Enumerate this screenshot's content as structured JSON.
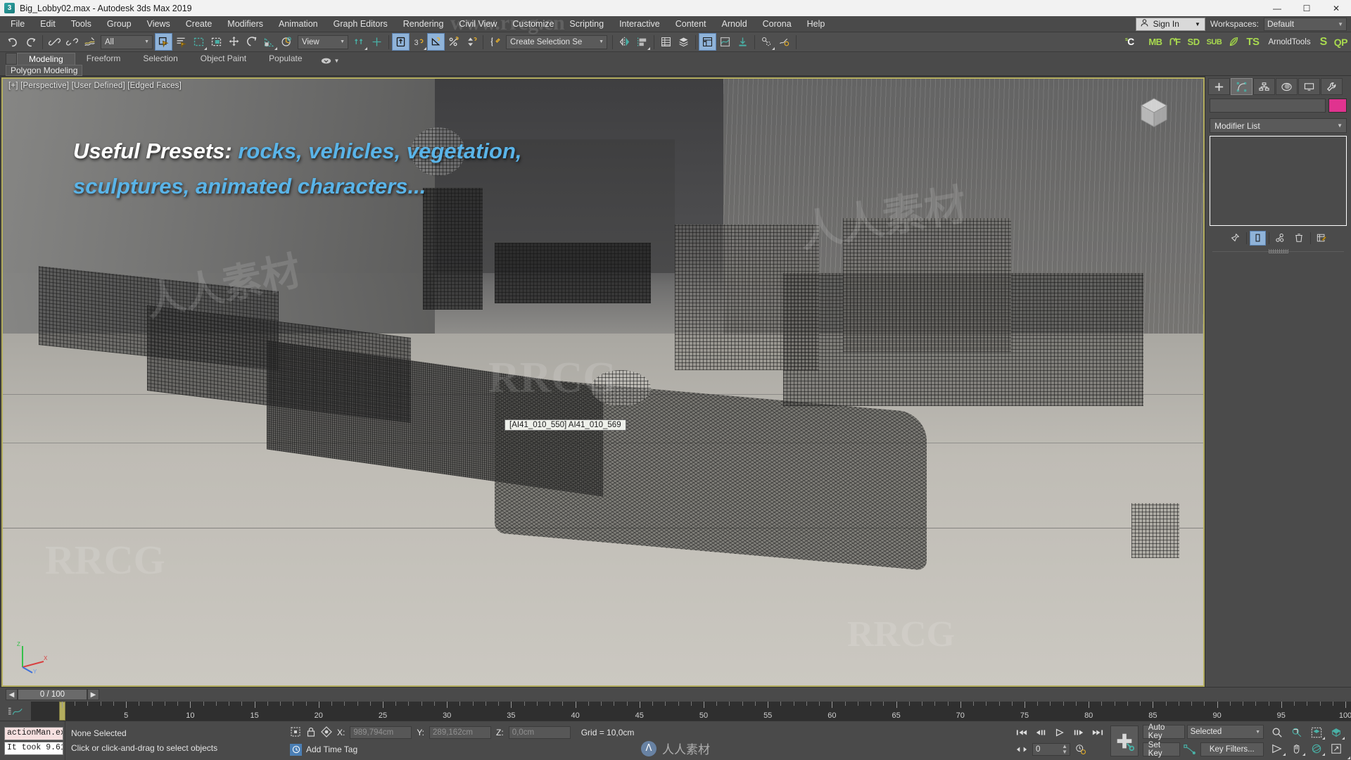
{
  "window": {
    "title": "Big_Lobby02.max - Autodesk 3ds Max 2019",
    "app_icon": "3",
    "minimize": "—",
    "maximize": "☐",
    "close": "✕"
  },
  "menubar": {
    "items": [
      "File",
      "Edit",
      "Tools",
      "Group",
      "Views",
      "Create",
      "Modifiers",
      "Animation",
      "Graph Editors",
      "Rendering",
      "Civil View",
      "Customize",
      "Scripting",
      "Interactive",
      "Content",
      "Arnold",
      "Corona",
      "Help"
    ],
    "sign_in": "Sign In",
    "workspaces_label": "Workspaces:",
    "workspace_value": "Default"
  },
  "toolbar": {
    "selection_filter": "All",
    "reference_coordinate": "View",
    "named_selection_sets": "Create Selection Se",
    "arnold_tools_label": "ArnoldTools",
    "plugin_icons": [
      "SC",
      "MB",
      "FF",
      "SD",
      "SUB",
      "leaf-icon",
      "TS",
      "S",
      "QP"
    ]
  },
  "ribbon": {
    "tabs": [
      "Modeling",
      "Freeform",
      "Selection",
      "Object Paint",
      "Populate"
    ],
    "active_tab": "Modeling",
    "panel_label": "Polygon Modeling"
  },
  "viewport": {
    "label": "[+] [Perspective] [User Defined] [Edged Faces]",
    "tooltip": "[AI41_010_550] AI41_010_569",
    "overlay_title": "Useful Presets:",
    "overlay_accent_line1": " rocks, vehicles, vegetation,",
    "overlay_accent_line2": "sculptures, animated characters...",
    "accent_color": "#5ab4e8",
    "border_color": "#b3ad5e",
    "axis_x": "X",
    "axis_y": "Y",
    "axis_z": "Z"
  },
  "command_panel": {
    "tabs": [
      "create-tab",
      "modify-tab",
      "hierarchy-tab",
      "motion-tab",
      "display-tab",
      "utilities-tab"
    ],
    "active_tab_index": 1,
    "object_name": "",
    "color_swatch": "#e0338f",
    "modifier_list": "Modifier List"
  },
  "timeline": {
    "frame_display": "0 / 100",
    "prev_arrow": "◀",
    "next_arrow": "▶",
    "tick_labels": [
      "5",
      "10",
      "15",
      "20",
      "25",
      "30",
      "35",
      "40",
      "45",
      "50",
      "55",
      "60",
      "65",
      "70",
      "75",
      "80",
      "85",
      "90",
      "95",
      "100"
    ],
    "current_frame": 0,
    "frame_range": [
      0,
      100
    ]
  },
  "statusbar": {
    "maxscript_prompt": "actionMan.ex",
    "maxscript_result": "It took 9.61",
    "selection_status": "None Selected",
    "prompt": "Click or click-and-drag to select objects",
    "coord_x_label": "X:",
    "coord_x_value": "989,794cm",
    "coord_y_label": "Y:",
    "coord_y_value": "289,162cm",
    "coord_z_label": "Z:",
    "coord_z_value": "0,0cm",
    "grid_label": "Grid = 10,0cm",
    "add_time_tag": "Add Time Tag"
  },
  "animation": {
    "auto_key": "Auto Key",
    "set_key": "Set Key",
    "key_filters": "Key Filters...",
    "selected_level": "Selected",
    "frame_spinner": "0",
    "go_to_start": "⏮",
    "prev_frame": "⏴",
    "play": "▶",
    "next_frame": "⏵",
    "go_to_end": "⏭"
  },
  "watermarks": {
    "marks": [
      "RRCG",
      "www.rrcg.cn",
      "人人素材",
      "RRCG"
    ],
    "bottom_text": "人人素材"
  }
}
